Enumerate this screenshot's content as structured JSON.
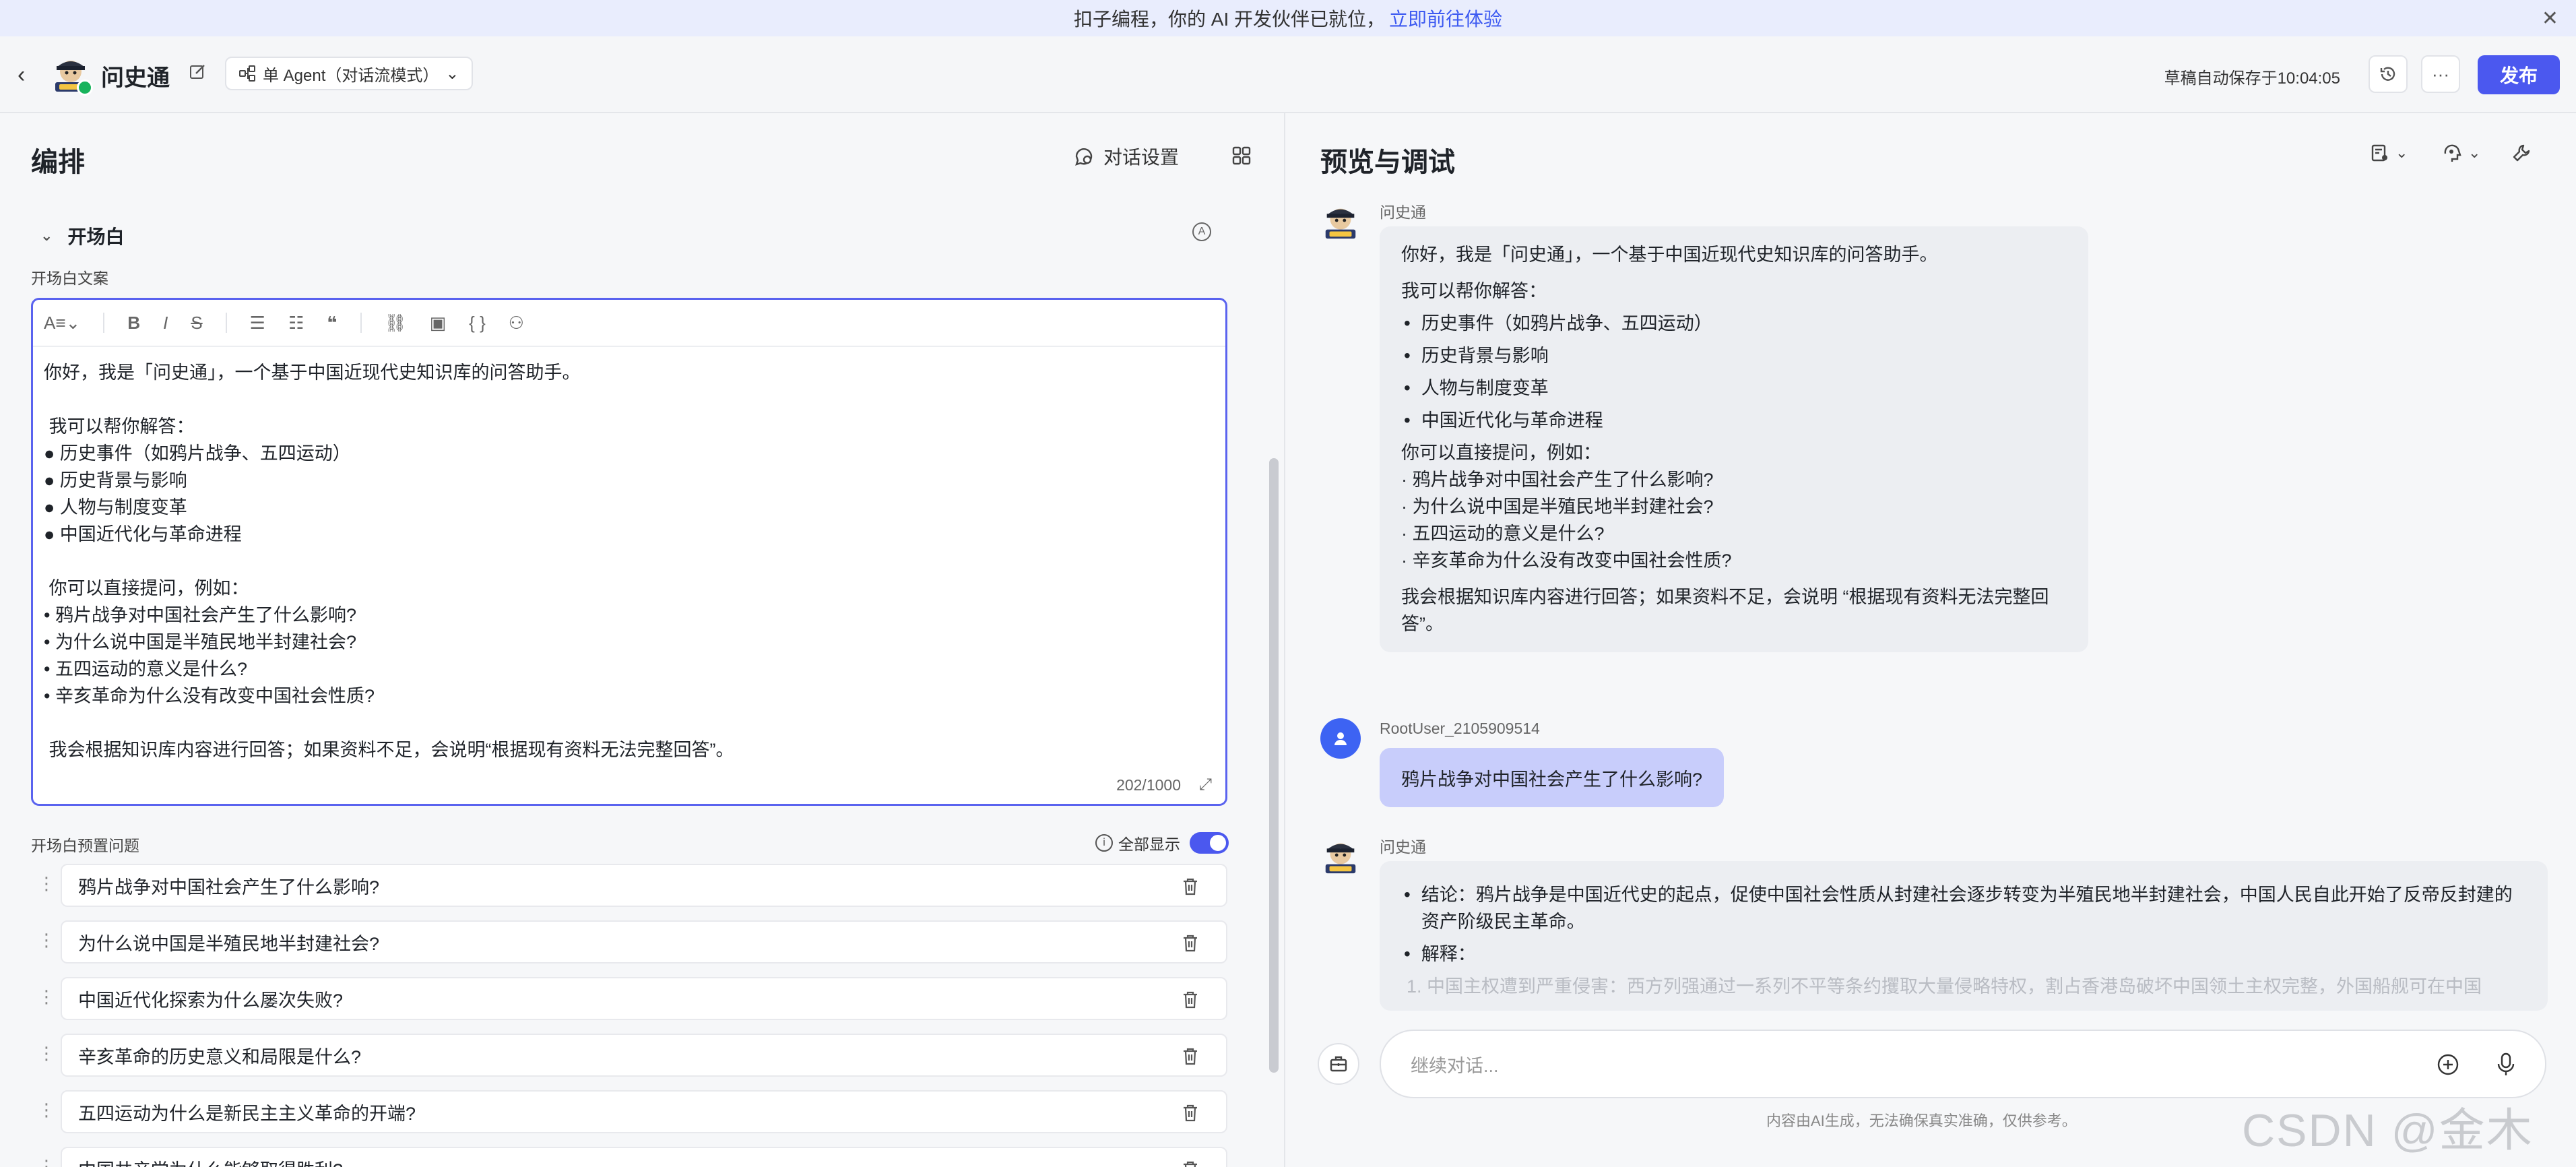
{
  "banner": {
    "text": "扣子编程，你的 AI 开发伙伴已就位，",
    "link": "立即前往体验"
  },
  "header": {
    "back": "‹",
    "app_name": "问史通",
    "agent_mode": "单 Agent（对话流模式）",
    "save_status": "草稿自动保存于10:04:05",
    "more": "···",
    "publish": "发布"
  },
  "left": {
    "title": "编排",
    "dialog_settings": "对话设置",
    "section_title": "开场白",
    "opening_label": "开场白文案",
    "toolbar": [
      "A",
      "B",
      "I",
      "S",
      "≔",
      "⒈",
      "66",
      "🔗",
      "▣",
      "{ }",
      "👤"
    ],
    "editor_lines": [
      "你好，我是「问史通」，一个基于中国近现代史知识库的问答助手。",
      "",
      " 我可以帮你解答：",
      "● 历史事件（如鸦片战争、五四运动）",
      "● 历史背景与影响",
      "● 人物与制度变革",
      "● 中国近代化与革命进程",
      "",
      " 你可以直接提问，例如：",
      "• 鸦片战争对中国社会产生了什么影响?",
      "• 为什么说中国是半殖民地半封建社会?",
      "• 五四运动的意义是什么?",
      "• 辛亥革命为什么没有改变中国社会性质?",
      "",
      " 我会根据知识库内容进行回答；如果资料不足，会说明“根据现有资料无法完整回答”。"
    ],
    "char_count": "202/1000",
    "preset_label": "开场白预置问题",
    "show_all": "全部显示",
    "preset_questions": [
      "鸦片战争对中国社会产生了什么影响?",
      "为什么说中国是半殖民地半封建社会?",
      "中国近代化探索为什么屡次失败?",
      "辛亥革命的历史意义和局限是什么?",
      "五四运动为什么是新民主主义革命的开端?",
      "中国共产党为什么能够取得胜利?"
    ]
  },
  "right": {
    "title": "预览与调试",
    "bot_name": "问史通",
    "bot_greeting": {
      "intro": "你好，我是「问史通」，一个基于中国近现代史知识库的问答助手。",
      "can_help": "我可以帮你解答：",
      "bullets": [
        "历史事件（如鸦片战争、五四运动）",
        "历史背景与影响",
        "人物与制度变革",
        "中国近代化与革命进程"
      ],
      "ask_intro": "你可以直接提问，例如：",
      "examples": [
        "· 鸦片战争对中国社会产生了什么影响?",
        "· 为什么说中国是半殖民地半封建社会?",
        "· 五四运动的意义是什么?",
        "· 辛亥革命为什么没有改变中国社会性质?"
      ],
      "note": "我会根据知识库内容进行回答；如果资料不足，会说明 “根据现有资料无法完整回答”。"
    },
    "user_name": "RootUser_2105909514",
    "user_message": "鸦片战争对中国社会产生了什么影响?",
    "bot_name_2": "问史通",
    "answer": {
      "conclusion": "结论：鸦片战争是中国近代史的起点，促使中国社会性质从封建社会逐步转变为半殖民地半封建社会，中国人民自此开始了反帝反封建的资产阶级民主革命。",
      "explain": "解释：",
      "point1": "1. 中国主权遭到严重侵害：西方列强通过一系列不平等条约攫取大量侵略特权，割占香港岛破坏中国领土主权完整，外国船舰可在中国"
    },
    "input_placeholder": "继续对话...",
    "disclaimer": "内容由AI生成，无法确保真实准确，仅供参考。"
  },
  "watermark": "CSDN @金木AI",
  "colors": {
    "accent": "#4b58ef",
    "user_bubble": "#c8cdfb",
    "bot_bubble": "#eceef2"
  }
}
